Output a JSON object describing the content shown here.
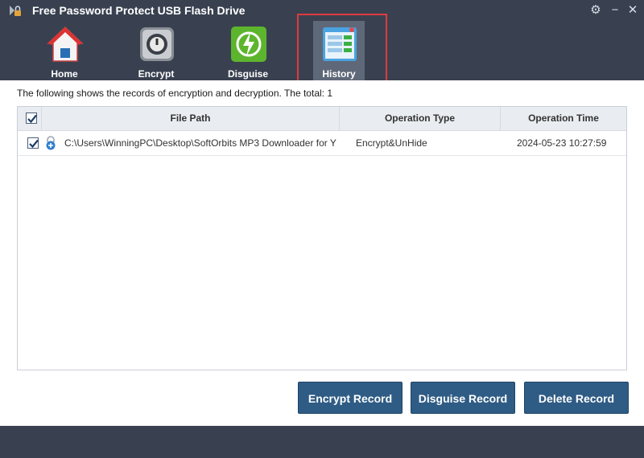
{
  "window": {
    "title": "Free Password Protect USB Flash Drive",
    "controls": {
      "settings_icon": "gear-icon",
      "minimize_icon": "minimize-icon",
      "close_icon": "close-icon"
    }
  },
  "toolbar": {
    "items": [
      {
        "label": "Home",
        "icon": "home-icon"
      },
      {
        "label": "Encrypt",
        "icon": "safe-icon"
      },
      {
        "label": "Disguise",
        "icon": "disguise-icon"
      },
      {
        "label": "History",
        "icon": "history-icon",
        "selected": true
      }
    ]
  },
  "history": {
    "summary": "The following shows the records of encryption and decryption. The total: 1",
    "columns": [
      "File Path",
      "Operation Type",
      "Operation Time"
    ],
    "rows": [
      {
        "checked": true,
        "file_path": "C:\\Users\\WinningPC\\Desktop\\SoftOrbits MP3 Downloader for Y",
        "operation_type": "Encrypt&UnHide",
        "operation_time": "2024-05-23 10:27:59"
      }
    ],
    "select_all_checked": true
  },
  "buttons": {
    "encrypt_record": "Encrypt Record",
    "disguise_record": "Disguise Record",
    "delete_record": "Delete Record"
  },
  "colors": {
    "frame": "#394150",
    "button": "#2f5c85",
    "highlight": "#e03a3f"
  }
}
